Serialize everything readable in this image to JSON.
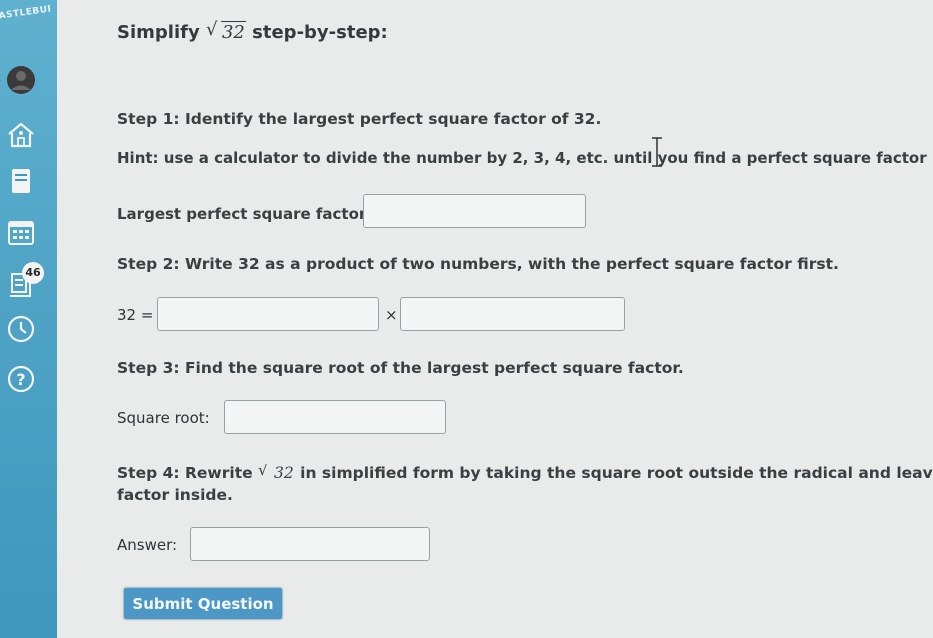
{
  "sidebar": {
    "logo_text": "ASTLEBURY",
    "notifications_count": "46",
    "icons": [
      "avatar-icon",
      "home-icon",
      "notebook-icon",
      "calendar-icon",
      "assignments-icon",
      "clock-icon",
      "help-icon"
    ]
  },
  "question": {
    "title_prefix": "Simplify",
    "radicand": "32",
    "title_suffix": "step-by-step:"
  },
  "step1": {
    "label": "Step 1:",
    "text": "Identify the largest perfect square factor of 32.",
    "hint": "Hint: use a calculator to divide the number by 2, 3, 4, etc. until you find a perfect square factor",
    "field_label": "Largest perfect square factor:",
    "field_value": ""
  },
  "step2": {
    "label": "Step 2:",
    "text": "Write 32 as a product of two numbers, with the perfect square factor first.",
    "lhs": "32 =",
    "times": "×",
    "factor1_value": "",
    "factor2_value": ""
  },
  "step3": {
    "label": "Step 3:",
    "text": "Find the square root of the largest perfect square factor.",
    "field_label": "Square root:",
    "field_value": ""
  },
  "step4": {
    "label": "Step 4:",
    "text_before": "Rewrite",
    "radicand": "32",
    "text_after": "in simplified form by taking the square root outside the radical and leaving the",
    "text_line2": "factor inside.",
    "field_label": "Answer:",
    "field_value": ""
  },
  "submit_label": "Submit Question"
}
